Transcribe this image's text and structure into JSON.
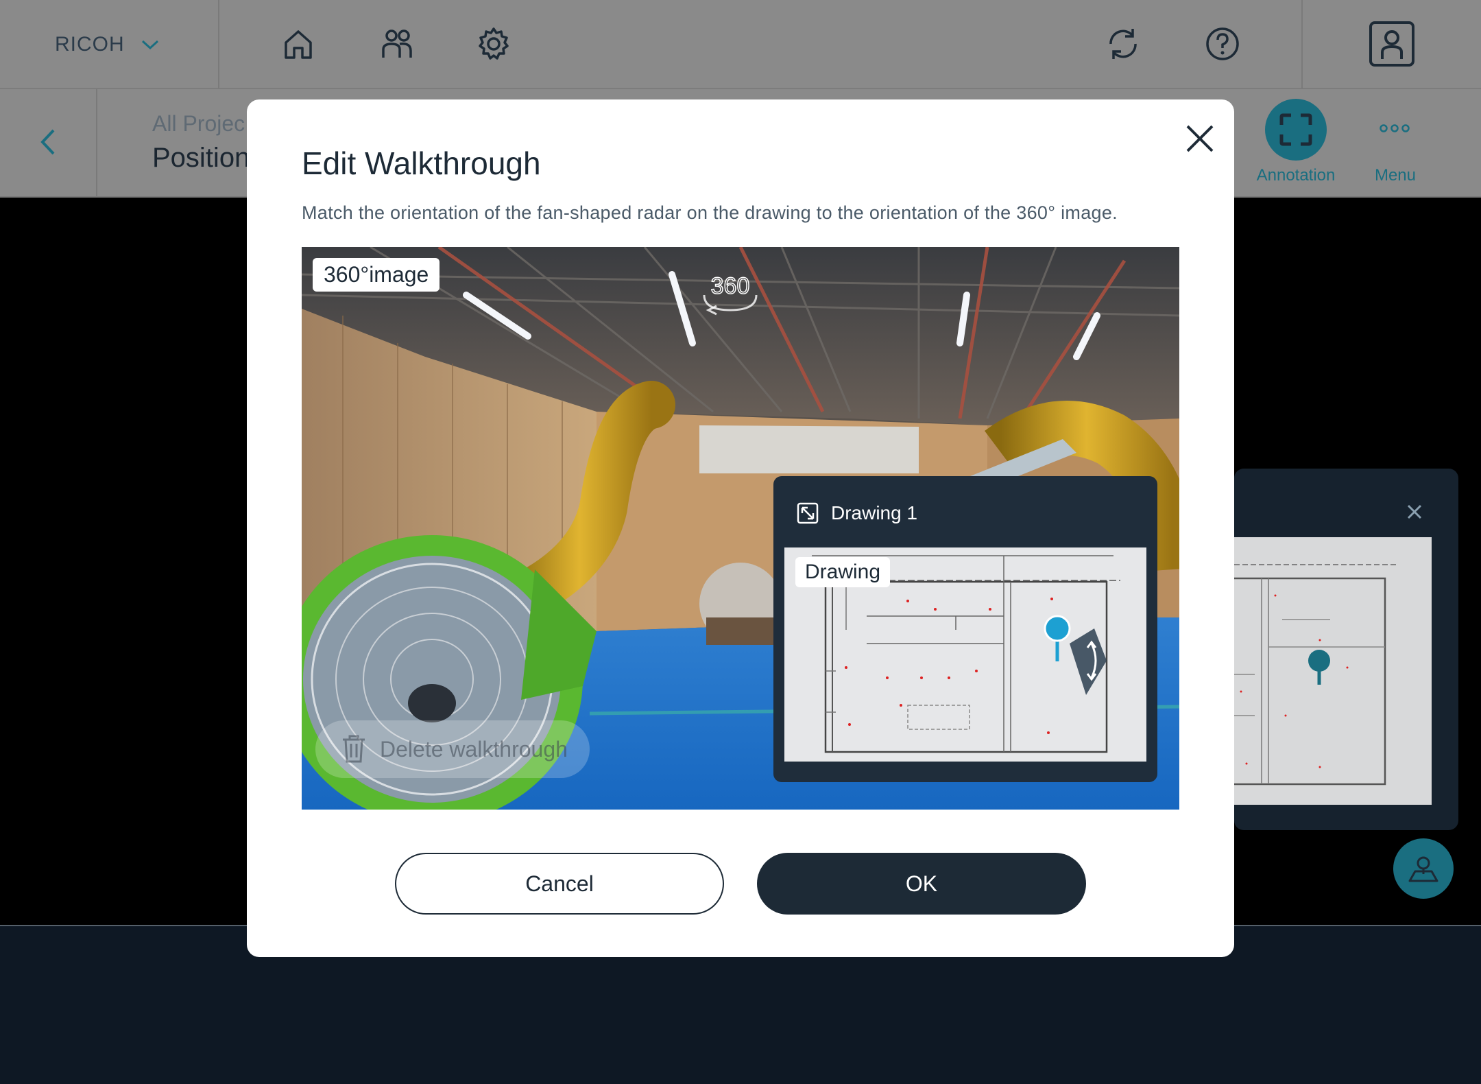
{
  "topbar": {
    "brand": "RICOH",
    "icons": [
      "home-icon",
      "users-icon",
      "settings-gear-icon",
      "sync-icon",
      "help-icon",
      "account-icon"
    ]
  },
  "subbar": {
    "breadcrumb": "All Projec",
    "page_title": "Position",
    "annotation_label": "Annotation",
    "menu_label": "Menu"
  },
  "modal": {
    "title": "Edit Walkthrough",
    "description": "Match the orientation of the fan-shaped radar on the drawing to the orientation of the 360° image.",
    "image_tag": "360°image",
    "image_badge": "360",
    "delete_label": "Delete walkthrough",
    "mini_map": {
      "title": "Drawing 1",
      "tag": "Drawing"
    },
    "cancel_label": "Cancel",
    "ok_label": "OK"
  },
  "colors": {
    "accent": "#1a6e80",
    "pin": "#1da0d2",
    "dark": "#1d2a36",
    "overlay": "#8a8a8a"
  }
}
